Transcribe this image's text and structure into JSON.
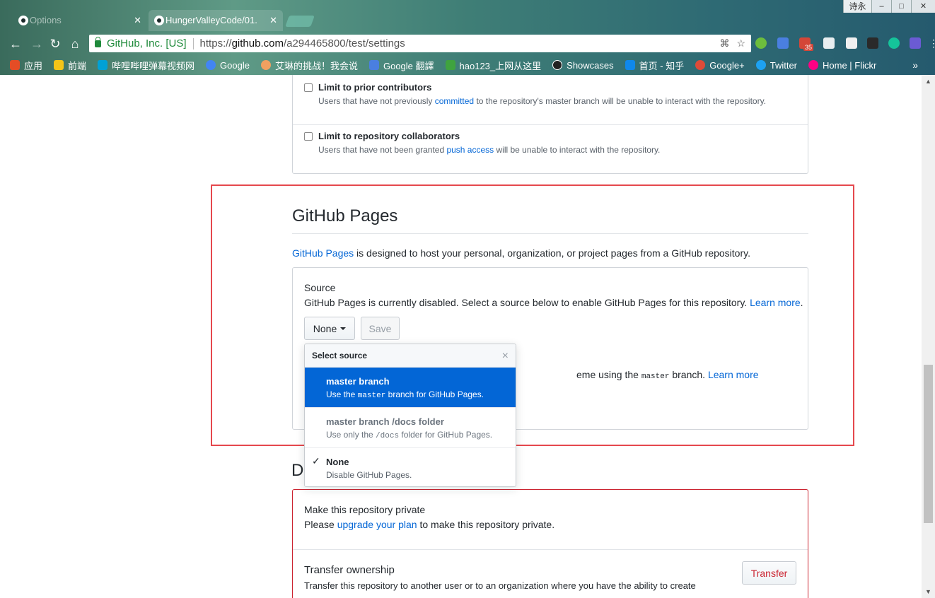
{
  "browser": {
    "tabs": [
      {
        "label": "Options"
      },
      {
        "label": "HungerValleyCode/01."
      }
    ],
    "user_label": "诗永",
    "window_controls": {
      "min": "–",
      "max": "□",
      "close": "✕"
    },
    "omnibox": {
      "org": "GitHub, Inc. [US]",
      "url_prefix": "https://",
      "url_host": "github.com",
      "url_path": "/a294465800/test/settings"
    },
    "mail_badge": "35",
    "bookmarks": [
      {
        "label": "应用",
        "color": "#e44d26"
      },
      {
        "label": "前端",
        "color": "#f5c518"
      },
      {
        "label": "哔哩哔哩弹幕视频网",
        "color": "#00a1d6"
      },
      {
        "label": "Google",
        "color": "#4285f4"
      },
      {
        "label": "艾琳的挑战！我会说",
        "color": "#f0a060"
      },
      {
        "label": "Google 翻譯",
        "color": "#4a7fe0"
      },
      {
        "label": "hao123_上网从这里",
        "color": "#3fa33f"
      },
      {
        "label": "Showcases",
        "color": "#222222"
      },
      {
        "label": "首页 - 知乎",
        "color": "#0f88eb"
      },
      {
        "label": "Google+",
        "color": "#dd4b39"
      },
      {
        "label": "Twitter",
        "color": "#1da1f2"
      },
      {
        "label": "Home | Flickr",
        "color": "#ff0084"
      }
    ],
    "bookmarks_more": "»"
  },
  "collab": {
    "prior": {
      "title": "Limit to prior contributors",
      "desc_before": "Users that have not previously ",
      "desc_link": "committed",
      "desc_after": " to the repository's master branch will be unable to interact with the repository."
    },
    "collaborators": {
      "title": "Limit to repository collaborators",
      "desc_before": "Users that have not been granted ",
      "desc_link": "push access",
      "desc_after": " will be unable to interact with the repository."
    }
  },
  "pages": {
    "heading": "GitHub Pages",
    "intro_link": "GitHub Pages",
    "intro_rest": " is designed to host your personal, organization, or project pages from a GitHub repository.",
    "source_label": "Source",
    "source_desc": "GitHub Pages is currently disabled. Select a source below to enable GitHub Pages for this repository. ",
    "learn_more": "Learn more",
    "none_button": "None",
    "save_button": "Save",
    "theme_before": "eme using the ",
    "theme_code": "master",
    "theme_after": " branch. ",
    "theme_link": "Learn more"
  },
  "menu": {
    "header": "Select source",
    "close": "×",
    "items": [
      {
        "title": "master branch",
        "desc_before": "Use the ",
        "desc_code": "master",
        "desc_after": " branch for GitHub Pages."
      },
      {
        "title": "master branch /docs folder",
        "desc_before": "Use only the ",
        "desc_code": "/docs",
        "desc_after": " folder for GitHub Pages."
      },
      {
        "title": "None",
        "desc": "Disable GitHub Pages.",
        "check": "✓"
      }
    ]
  },
  "danger": {
    "heading_partial": "D",
    "private": {
      "title": "Make this repository private",
      "desc_before": "Please ",
      "desc_link": "upgrade your plan",
      "desc_after": " to make this repository private."
    },
    "transfer": {
      "title": "Transfer ownership",
      "desc": "Transfer this repository to another user or to an organization where you have the ability to create",
      "button": "Transfer"
    }
  }
}
